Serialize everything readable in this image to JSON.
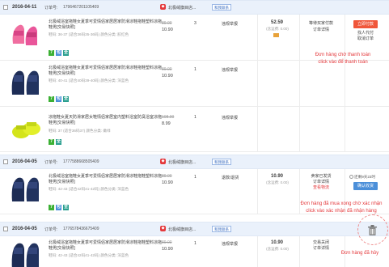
{
  "orders": [
    {
      "date": "2016-04-11",
      "order_label": "订单号:",
      "order_no": "1796467201105409",
      "shop": "北极绒旗目店...",
      "contact": "和我联系",
      "items": [
        {
          "title": "北极绒浴室拖鞋女夏季可爱情侣家居居家防滑凉鞋拖鞋塑料凉拖鞋男[交易快照]",
          "spec": "鞋码: 36-37 (适合36码35-36码)  颜色分类: 胶红色",
          "badges": [
            "7",
            "包",
            "全"
          ],
          "old_price": "89.00",
          "price": "10.90",
          "qty": "3",
          "service": "违规举报"
        },
        {
          "title": "北极绒浴室拖鞋女夏季可爱情侣家居居家防滑凉鞋拖鞋塑料凉拖鞋男[交易快照]",
          "spec": "鞋码: 40-41 (适合40码39-40码)  颜色分类: 深蓝色",
          "badges": [
            "7",
            "包",
            "全"
          ],
          "old_price": "89.00",
          "price": "10.90",
          "qty": "1",
          "service": "违规举报"
        },
        {
          "title": "凉拖鞋女夏天防滑家居女鞋情侣家居室内塑料浴室防臭浴室凉拖鞋男[交易快照]",
          "spec": "鞋码: 37 (适合36码37)  颜色分类: 嫩绿",
          "badges": [
            "7",
            "全"
          ],
          "old_price": "108.00",
          "price": "8.99",
          "qty": "1",
          "service": "违规举报"
        }
      ],
      "total": "52.59",
      "shipping": "(含运费: 0.00)",
      "status": [
        "等待买家付款",
        "订单详情"
      ],
      "actions": [
        "立即付款",
        "找人代付",
        "取消订单"
      ]
    },
    {
      "date": "2016-04-05",
      "order_label": "订单号:",
      "order_no": "1777588668505409",
      "shop": "北极绒旗目店...",
      "contact": "和我联系",
      "items": [
        {
          "title": "北极绒浴室拖鞋女夏季可爱情侣家居居家防滑凉鞋拖鞋塑料凉拖鞋男[交易快照]",
          "spec": "鞋码: 42-43 (适合42码41-42码)  颜色分类: 深蓝色",
          "badges": [
            "7",
            "包",
            "全"
          ],
          "old_price": "89.00",
          "price": "10.90",
          "qty": "1",
          "service": "退款/退货"
        }
      ],
      "total": "10.90",
      "shipping": "(含运费: 0.00)",
      "status": [
        "卖家已发货",
        "订单详情",
        "查看物流"
      ],
      "remind": "还剩9天23时",
      "actions": [
        "确认收货"
      ]
    },
    {
      "date": "2016-04-05",
      "order_label": "订单号:",
      "order_no": "1776578436675409",
      "shop": "北极绒旗目店...",
      "contact": "和我联系",
      "items": [
        {
          "title": "北极绒浴室拖鞋女夏季可爱情侣家居居家防滑凉鞋拖鞋塑料凉拖鞋男[交易快照]",
          "spec": "鞋码: 42-43 (适合42码41-42码)  颜色分类: 深蓝色",
          "badges": [
            "7",
            "包"
          ],
          "old_price": "89.00",
          "price": "10.90",
          "qty": "1",
          "service": "违规举报"
        }
      ],
      "total": "10.90",
      "shipping": "(含运费: 0.00)",
      "status": [
        "交易关闭",
        "订单详情"
      ]
    }
  ],
  "notes": {
    "unpaid": "Đơn hàng chờ thanh toán\nclick vào để thanh toán",
    "confirm": "Đơn hàng đã mua xong chờ xác nhận\nclick vào xác nhận đã nhận hàng",
    "cancelled": "Đơn hàng đã hủy"
  },
  "colors": {
    "header_bg": "#eaf1fb",
    "accent_red": "#e4393c",
    "button_orange": "#f0563a",
    "button_blue": "#4b8fd9"
  }
}
